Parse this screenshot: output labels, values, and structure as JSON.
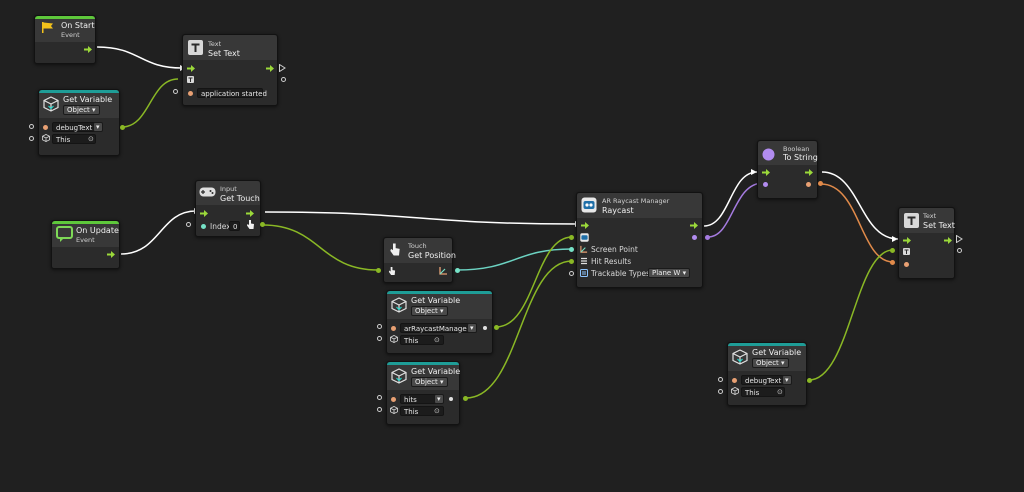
{
  "colors": {
    "flow": "#9bd93a",
    "string_port": "#e8a073",
    "object_port": "#d8c060",
    "bool_port": "#b28cf0",
    "vector_port": "#76e2c7",
    "teal_bar": "#1e9d97",
    "green_bar": "#5ec83b",
    "wire_flow": "#ffffff",
    "wire_green": "#8ab825",
    "wire_teal": "#6cd3c2",
    "wire_orange": "#e08a4a",
    "wire_purple": "#a57be0"
  },
  "nodes": {
    "on_start": {
      "title": "On Start",
      "kicker": "Event",
      "icon": "flag-icon"
    },
    "set_text_1": {
      "kicker": "Text",
      "title": "Set Text",
      "value": "application started",
      "icon": "text-icon"
    },
    "get_var_1": {
      "title": "Get Variable",
      "kind": "Object",
      "var": "debugText",
      "scope": "This",
      "icon": "variable-cube-icon"
    },
    "on_update": {
      "title": "On Update",
      "kicker": "Event",
      "icon": "update-loop-icon"
    },
    "get_touch": {
      "kicker": "Input",
      "title": "Get Touch",
      "index_label": "Index",
      "index_value": "0",
      "icon": "gamepad-icon"
    },
    "get_position": {
      "kicker": "Touch",
      "title": "Get Position",
      "icon": "touch-hand-icon"
    },
    "get_var_2": {
      "title": "Get Variable",
      "kind": "Object",
      "var": "arRaycastManager",
      "scope": "This",
      "icon": "variable-cube-icon"
    },
    "get_var_3": {
      "title": "Get Variable",
      "kind": "Object",
      "var": "hits",
      "scope": "This",
      "icon": "variable-cube-icon"
    },
    "raycast": {
      "kicker": "AR Raycast Manager",
      "title": "Raycast",
      "port1": "Screen Point",
      "port2": "Hit Results",
      "port3": "Trackable Types",
      "trackable_value": "Plane W",
      "icon": "ar-robot-icon"
    },
    "to_string": {
      "kicker": "Boolean",
      "title": "To String",
      "icon": "boolean-dot-icon"
    },
    "set_text_2": {
      "kicker": "Text",
      "title": "Set Text",
      "icon": "text-icon"
    },
    "get_var_4": {
      "title": "Get Variable",
      "kind": "Object",
      "var": "debugText",
      "scope": "This",
      "icon": "variable-cube-icon"
    }
  }
}
